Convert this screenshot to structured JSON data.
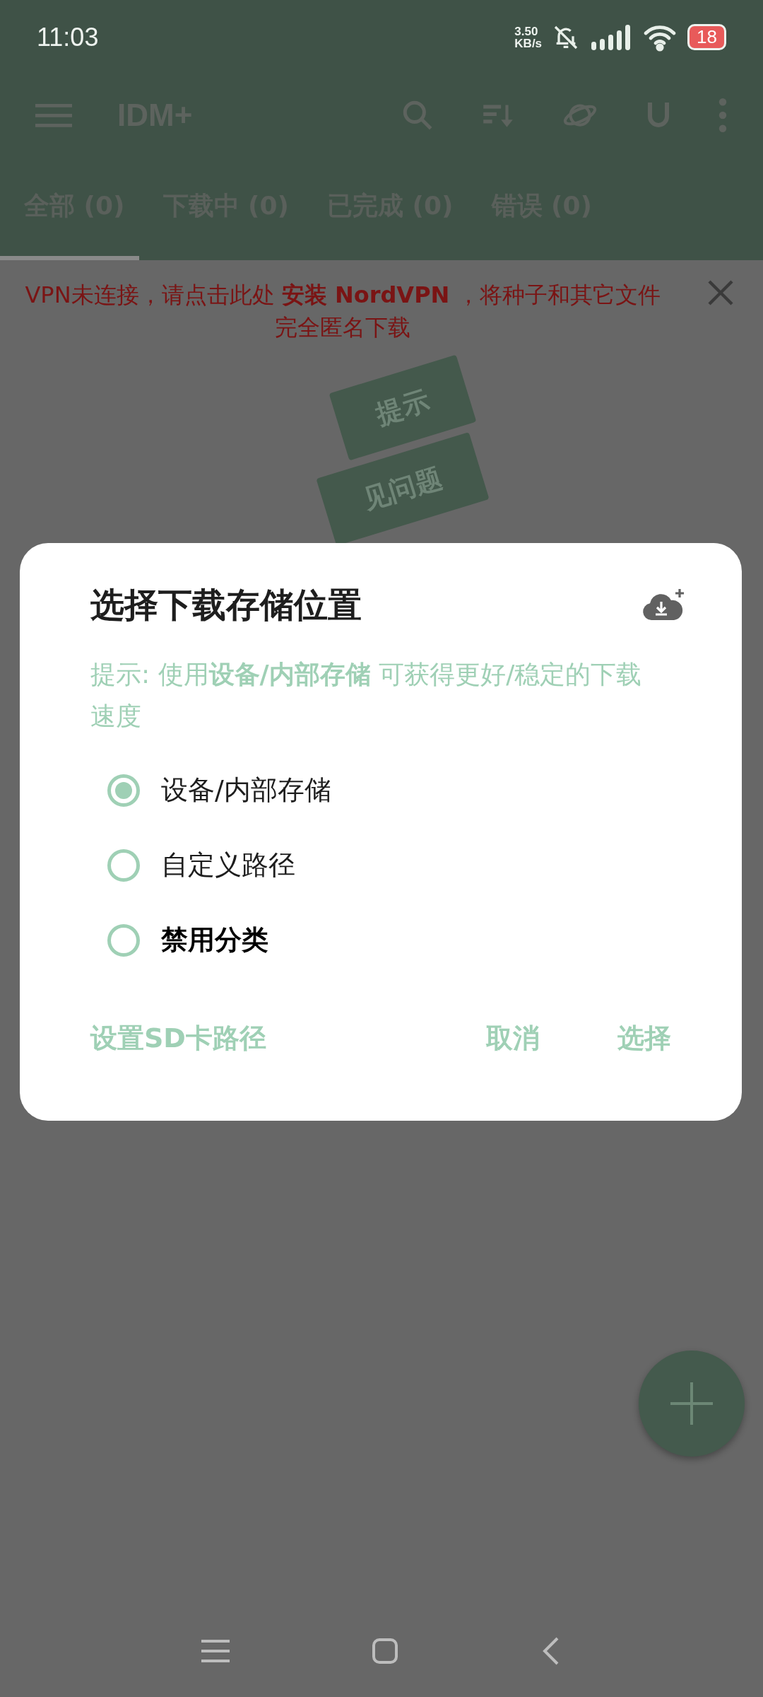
{
  "status_bar": {
    "time": "11:03",
    "net_speed_value": "3.50",
    "net_speed_unit": "KB/s",
    "battery": "18"
  },
  "app_bar": {
    "title": "IDM+"
  },
  "tabs": [
    {
      "label": "全部 (0)",
      "selected": true
    },
    {
      "label": "下载中 (0)",
      "selected": false
    },
    {
      "label": "已完成 (0)",
      "selected": false
    },
    {
      "label": "错误 (0)",
      "selected": false
    }
  ],
  "vpn_banner": {
    "message": "VPN未连接，请点击此处 **安装 NordVPN** ，将种子和其它文件完全匿名下载"
  },
  "background_buttons": [
    "提示",
    "见问题"
  ],
  "dialog": {
    "title": "选择下载存储位置",
    "hint": "提示: 使用**设备/内部存储** 可获得更好/稳定的下载速度",
    "options": [
      {
        "label": "设备/内部存储",
        "selected": true,
        "bold": false
      },
      {
        "label": "自定义路径",
        "selected": false,
        "bold": false
      },
      {
        "label": "禁用分类",
        "selected": false,
        "bold": true
      }
    ],
    "buttons": [
      "设置SD卡路径",
      "取消",
      "选择"
    ]
  }
}
